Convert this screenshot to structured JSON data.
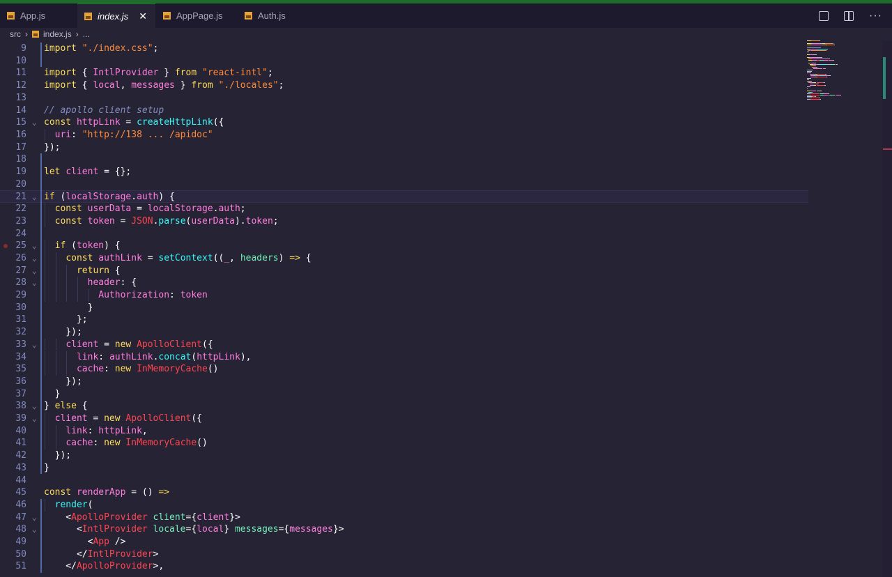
{
  "tabs": [
    {
      "label": "App.js",
      "active": false
    },
    {
      "label": "index.js",
      "active": true
    },
    {
      "label": "AppPage.js",
      "active": false
    },
    {
      "label": "Auth.js",
      "active": false
    }
  ],
  "tab_close": "✕",
  "tab_more": "···",
  "breadcrumb": {
    "folder": "src",
    "file": "index.js",
    "more": "..."
  },
  "editor": {
    "current_line": 21,
    "breakpoint_line": 25,
    "lines": [
      {
        "n": 9,
        "code": [
          [
            "k",
            "import "
          ],
          [
            "s",
            "\"./index.css\""
          ],
          [
            "p",
            ";"
          ]
        ]
      },
      {
        "n": 10,
        "code": []
      },
      {
        "n": 11,
        "code": [
          [
            "k",
            "import "
          ],
          [
            "p",
            "{ "
          ],
          [
            "v",
            "IntlProvider"
          ],
          [
            "p",
            " } "
          ],
          [
            "k",
            "from "
          ],
          [
            "s",
            "\"react-intl\""
          ],
          [
            "p",
            ";"
          ]
        ]
      },
      {
        "n": 12,
        "code": [
          [
            "k",
            "import "
          ],
          [
            "p",
            "{ "
          ],
          [
            "v",
            "local"
          ],
          [
            "p",
            ", "
          ],
          [
            "v",
            "messages"
          ],
          [
            "p",
            " } "
          ],
          [
            "k",
            "from "
          ],
          [
            "s",
            "\"./locales\""
          ],
          [
            "p",
            ";"
          ]
        ]
      },
      {
        "n": 13,
        "code": []
      },
      {
        "n": 14,
        "code": [
          [
            "c",
            "// apollo client setup"
          ]
        ]
      },
      {
        "n": 15,
        "code": [
          [
            "k",
            "const "
          ],
          [
            "v",
            "httpLink"
          ],
          [
            "p",
            " = "
          ],
          [
            "f",
            "createHttpLink"
          ],
          [
            "p",
            "({"
          ]
        ]
      },
      {
        "n": 16,
        "code": [
          [
            "p",
            "  "
          ],
          [
            "pr",
            "uri"
          ],
          [
            "p",
            ": "
          ],
          [
            "s",
            "\"http://138 ... /apidoc\""
          ]
        ]
      },
      {
        "n": 17,
        "code": [
          [
            "p",
            "});"
          ]
        ]
      },
      {
        "n": 18,
        "code": []
      },
      {
        "n": 19,
        "code": [
          [
            "k",
            "let "
          ],
          [
            "v",
            "client"
          ],
          [
            "p",
            " = {};"
          ]
        ]
      },
      {
        "n": 20,
        "code": []
      },
      {
        "n": 21,
        "code": [
          [
            "k",
            "if "
          ],
          [
            "p",
            "("
          ],
          [
            "v",
            "localStorage"
          ],
          [
            "p",
            "."
          ],
          [
            "v",
            "auth"
          ],
          [
            "p",
            ") {"
          ]
        ]
      },
      {
        "n": 22,
        "code": [
          [
            "p",
            "  "
          ],
          [
            "k",
            "const "
          ],
          [
            "v",
            "userData"
          ],
          [
            "p",
            " = "
          ],
          [
            "v",
            "localStorage"
          ],
          [
            "p",
            "."
          ],
          [
            "v",
            "auth"
          ],
          [
            "p",
            ";"
          ]
        ]
      },
      {
        "n": 23,
        "code": [
          [
            "p",
            "  "
          ],
          [
            "k",
            "const "
          ],
          [
            "v",
            "token"
          ],
          [
            "p",
            " = "
          ],
          [
            "t",
            "JSON"
          ],
          [
            "p",
            "."
          ],
          [
            "f",
            "parse"
          ],
          [
            "p",
            "("
          ],
          [
            "v",
            "userData"
          ],
          [
            "p",
            ")."
          ],
          [
            "v",
            "token"
          ],
          [
            "p",
            ";"
          ]
        ]
      },
      {
        "n": 24,
        "code": []
      },
      {
        "n": 25,
        "code": [
          [
            "p",
            "  "
          ],
          [
            "k",
            "if "
          ],
          [
            "p",
            "("
          ],
          [
            "v",
            "token"
          ],
          [
            "p",
            ") {"
          ]
        ]
      },
      {
        "n": 26,
        "code": [
          [
            "p",
            "    "
          ],
          [
            "k",
            "const "
          ],
          [
            "v",
            "authLink"
          ],
          [
            "p",
            " = "
          ],
          [
            "f",
            "setContext"
          ],
          [
            "p",
            "(("
          ],
          [
            "v",
            "_"
          ],
          [
            "p",
            ", "
          ],
          [
            "i",
            "headers"
          ],
          [
            "p",
            ") "
          ],
          [
            "k",
            "=>"
          ],
          [
            "p",
            " {"
          ]
        ]
      },
      {
        "n": 27,
        "code": [
          [
            "p",
            "      "
          ],
          [
            "k",
            "return "
          ],
          [
            "p",
            "{"
          ]
        ]
      },
      {
        "n": 28,
        "code": [
          [
            "p",
            "        "
          ],
          [
            "pr",
            "header"
          ],
          [
            "p",
            ": {"
          ]
        ]
      },
      {
        "n": 29,
        "code": [
          [
            "p",
            "          "
          ],
          [
            "pr",
            "Authorization"
          ],
          [
            "p",
            ": "
          ],
          [
            "v",
            "token"
          ]
        ]
      },
      {
        "n": 30,
        "code": [
          [
            "p",
            "        }"
          ]
        ]
      },
      {
        "n": 31,
        "code": [
          [
            "p",
            "      };"
          ]
        ]
      },
      {
        "n": 32,
        "code": [
          [
            "p",
            "    });"
          ]
        ]
      },
      {
        "n": 33,
        "code": [
          [
            "p",
            "    "
          ],
          [
            "v",
            "client"
          ],
          [
            "p",
            " = "
          ],
          [
            "k",
            "new "
          ],
          [
            "t",
            "ApolloClient"
          ],
          [
            "p",
            "({"
          ]
        ]
      },
      {
        "n": 34,
        "code": [
          [
            "p",
            "      "
          ],
          [
            "pr",
            "link"
          ],
          [
            "p",
            ": "
          ],
          [
            "v",
            "authLink"
          ],
          [
            "p",
            "."
          ],
          [
            "f",
            "concat"
          ],
          [
            "p",
            "("
          ],
          [
            "v",
            "httpLink"
          ],
          [
            "p",
            "),"
          ]
        ]
      },
      {
        "n": 35,
        "code": [
          [
            "p",
            "      "
          ],
          [
            "pr",
            "cache"
          ],
          [
            "p",
            ": "
          ],
          [
            "k",
            "new "
          ],
          [
            "t",
            "InMemoryCache"
          ],
          [
            "p",
            "()"
          ]
        ]
      },
      {
        "n": 36,
        "code": [
          [
            "p",
            "    });"
          ]
        ]
      },
      {
        "n": 37,
        "code": [
          [
            "p",
            "  }"
          ]
        ]
      },
      {
        "n": 38,
        "code": [
          [
            "p",
            "} "
          ],
          [
            "k",
            "else "
          ],
          [
            "p",
            "{"
          ]
        ]
      },
      {
        "n": 39,
        "code": [
          [
            "p",
            "  "
          ],
          [
            "v",
            "client"
          ],
          [
            "p",
            " = "
          ],
          [
            "k",
            "new "
          ],
          [
            "t",
            "ApolloClient"
          ],
          [
            "p",
            "({"
          ]
        ]
      },
      {
        "n": 40,
        "code": [
          [
            "p",
            "    "
          ],
          [
            "pr",
            "link"
          ],
          [
            "p",
            ": "
          ],
          [
            "v",
            "httpLink"
          ],
          [
            "p",
            ","
          ]
        ]
      },
      {
        "n": 41,
        "code": [
          [
            "p",
            "    "
          ],
          [
            "pr",
            "cache"
          ],
          [
            "p",
            ": "
          ],
          [
            "k",
            "new "
          ],
          [
            "t",
            "InMemoryCache"
          ],
          [
            "p",
            "()"
          ]
        ]
      },
      {
        "n": 42,
        "code": [
          [
            "p",
            "  });"
          ]
        ]
      },
      {
        "n": 43,
        "code": [
          [
            "p",
            "}"
          ]
        ]
      },
      {
        "n": 44,
        "code": []
      },
      {
        "n": 45,
        "code": [
          [
            "k",
            "const "
          ],
          [
            "v",
            "renderApp"
          ],
          [
            "p",
            " = () "
          ],
          [
            "k",
            "=>"
          ]
        ]
      },
      {
        "n": 46,
        "code": [
          [
            "p",
            "  "
          ],
          [
            "f",
            "render"
          ],
          [
            "p",
            "("
          ]
        ]
      },
      {
        "n": 47,
        "code": [
          [
            "p",
            "    <"
          ],
          [
            "t",
            "ApolloProvider"
          ],
          [
            "p",
            " "
          ],
          [
            "i",
            "client"
          ],
          [
            "p",
            "={"
          ],
          [
            "v",
            "client"
          ],
          [
            "p",
            "}>"
          ]
        ]
      },
      {
        "n": 48,
        "code": [
          [
            "p",
            "      <"
          ],
          [
            "t",
            "IntlProvider"
          ],
          [
            "p",
            " "
          ],
          [
            "i",
            "locale"
          ],
          [
            "p",
            "={"
          ],
          [
            "v",
            "local"
          ],
          [
            "p",
            "} "
          ],
          [
            "i",
            "messages"
          ],
          [
            "p",
            "={"
          ],
          [
            "v",
            "messages"
          ],
          [
            "p",
            "}>"
          ]
        ]
      },
      {
        "n": 49,
        "code": [
          [
            "p",
            "        <"
          ],
          [
            "t",
            "App"
          ],
          [
            "p",
            " />"
          ]
        ]
      },
      {
        "n": 50,
        "code": [
          [
            "p",
            "      </"
          ],
          [
            "t",
            "IntlProvider"
          ],
          [
            "p",
            ">"
          ]
        ]
      },
      {
        "n": 51,
        "code": [
          [
            "p",
            "    </"
          ],
          [
            "t",
            "ApolloProvider"
          ],
          [
            "p",
            ">,"
          ]
        ]
      }
    ],
    "folds": [
      15,
      21,
      25,
      26,
      27,
      28,
      33,
      38,
      39,
      47,
      48
    ]
  }
}
